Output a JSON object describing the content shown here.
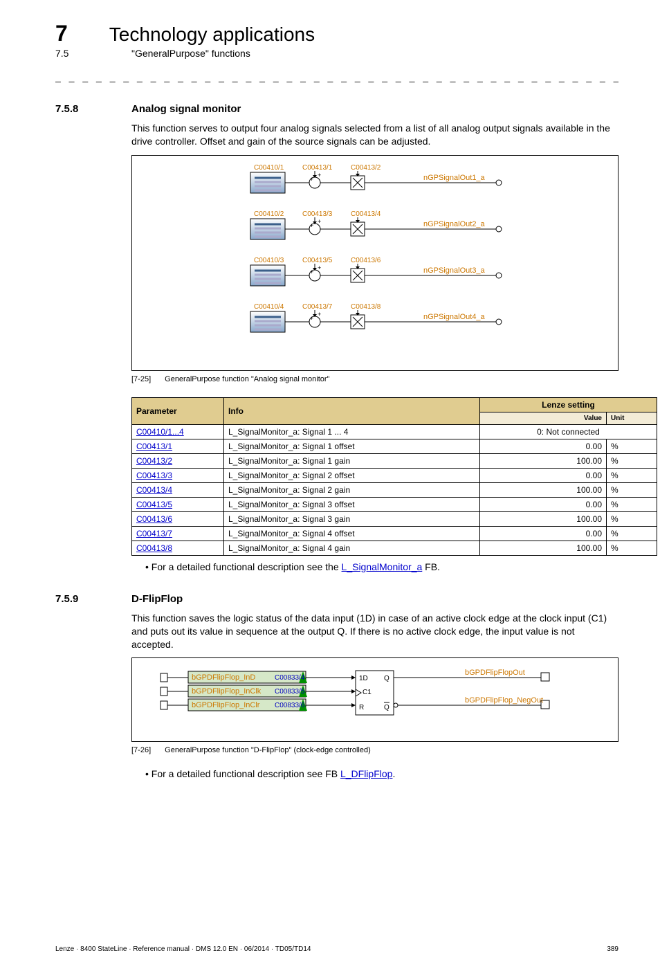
{
  "header": {
    "chapter_num": "7",
    "chapter_title": "Technology applications",
    "section_num": "7.5",
    "section_title": "\"GeneralPurpose\" functions"
  },
  "sec758": {
    "num": "7.5.8",
    "title": "Analog signal monitor",
    "para": "This function serves to output four analog signals selected from a list of all analog output signals available in the drive controller. Offset and gain of the source signals can be adjusted.",
    "fig": {
      "rows": [
        {
          "sel": "C00410/1",
          "off": "C00413/1",
          "gain": "C00413/2",
          "out": "nGPSignalOut1_a"
        },
        {
          "sel": "C00410/2",
          "off": "C00413/3",
          "gain": "C00413/4",
          "out": "nGPSignalOut2_a"
        },
        {
          "sel": "C00410/3",
          "off": "C00413/5",
          "gain": "C00413/6",
          "out": "nGPSignalOut3_a"
        },
        {
          "sel": "C00410/4",
          "off": "C00413/7",
          "gain": "C00413/8",
          "out": "nGPSignalOut4_a"
        }
      ]
    },
    "caption_tag": "[7-25]",
    "caption": "GeneralPurpose function \"Analog signal monitor\"",
    "table": {
      "headers": {
        "param": "Parameter",
        "info": "Info",
        "setting": "Lenze setting",
        "value": "Value",
        "unit": "Unit"
      },
      "rows": [
        {
          "p": "C00410/1...4",
          "i": "L_SignalMonitor_a: Signal 1 ... 4",
          "v": "0: Not connected",
          "u": ""
        },
        {
          "p": "C00413/1",
          "i": "L_SignalMonitor_a: Signal 1 offset",
          "v": "0.00",
          "u": "%"
        },
        {
          "p": "C00413/2",
          "i": "L_SignalMonitor_a: Signal 1 gain",
          "v": "100.00",
          "u": "%"
        },
        {
          "p": "C00413/3",
          "i": "L_SignalMonitor_a: Signal 2 offset",
          "v": "0.00",
          "u": "%"
        },
        {
          "p": "C00413/4",
          "i": "L_SignalMonitor_a: Signal 2 gain",
          "v": "100.00",
          "u": "%"
        },
        {
          "p": "C00413/5",
          "i": "L_SignalMonitor_a: Signal 3 offset",
          "v": "0.00",
          "u": "%"
        },
        {
          "p": "C00413/6",
          "i": "L_SignalMonitor_a: Signal 3 gain",
          "v": "100.00",
          "u": "%"
        },
        {
          "p": "C00413/7",
          "i": "L_SignalMonitor_a: Signal 4 offset",
          "v": "0.00",
          "u": "%"
        },
        {
          "p": "C00413/8",
          "i": "L_SignalMonitor_a: Signal 4 gain",
          "v": "100.00",
          "u": "%"
        }
      ]
    },
    "note_pre": "For a detailed functional description see the ",
    "note_link": "L_SignalMonitor_a",
    "note_post": " FB."
  },
  "sec759": {
    "num": "7.5.9",
    "title": "D-FlipFlop",
    "para": "This function saves the logic status of the data input (1D) in case of an active clock edge at the clock input (C1) and puts out its value in sequence at the output Q. If there is no active clock edge, the input value is not accepted.",
    "fig": {
      "inputs": [
        {
          "name": "bGPDFlipFlop_InD",
          "code": "C00833/4"
        },
        {
          "name": "bGPDFlipFlop_InClk",
          "code": "C00833/5"
        },
        {
          "name": "bGPDFlipFlop_InClr",
          "code": "C00833/6"
        }
      ],
      "block_labels": {
        "d": "1D",
        "c": "C1",
        "r": "R",
        "q": "Q",
        "qn": "Q̄"
      },
      "outputs": [
        "bGPDFlipFlopOut",
        "bGPDFlipFlop_NegOut"
      ]
    },
    "caption_tag": "[7-26]",
    "caption": "GeneralPurpose function \"D-FlipFlop\" (clock-edge controlled)",
    "note_pre": "For a detailed functional description see FB ",
    "note_link": "L_DFlipFlop",
    "note_post": "."
  },
  "footer": {
    "left": "Lenze · 8400 StateLine · Reference manual · DMS 12.0 EN · 06/2014 · TD05/TD14",
    "right": "389"
  }
}
